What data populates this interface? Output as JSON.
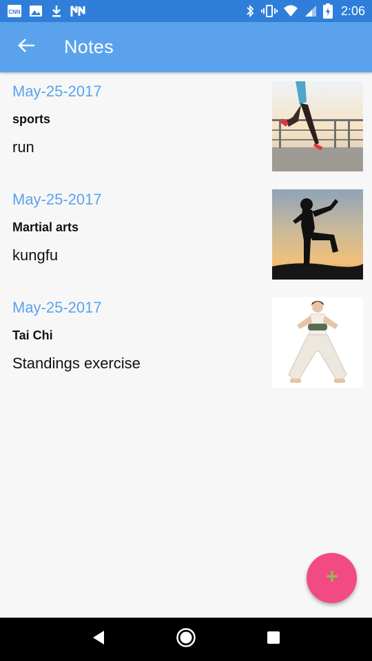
{
  "status_bar": {
    "time": "2:06",
    "left_icons": [
      "cnn-icon",
      "image-icon",
      "download-icon",
      "n-app-icon"
    ],
    "right_icons": [
      "bluetooth-icon",
      "vibrate-icon",
      "wifi-icon",
      "signal-icon",
      "battery-charging-icon"
    ]
  },
  "app_bar": {
    "title": "Notes",
    "back_icon": "arrow-left-icon"
  },
  "notes": [
    {
      "date": "May-25-2017",
      "title": "sports",
      "body": "run"
    },
    {
      "date": "May-25-2017",
      "title": "Martial arts",
      "body": "kungfu"
    },
    {
      "date": "May-25-2017",
      "title": "Tai Chi",
      "body": "Standings exercise"
    }
  ],
  "fab": {
    "icon": "plus-icon"
  },
  "nav_bar": {
    "icons": [
      "back-triangle-icon",
      "home-circle-icon",
      "recents-square-icon"
    ]
  },
  "colors": {
    "status_bar": "#2f7fda",
    "app_bar": "#5aa3ec",
    "date_text": "#5aa3ec",
    "fab": "#f24b83",
    "fab_icon": "#8bc34a"
  }
}
